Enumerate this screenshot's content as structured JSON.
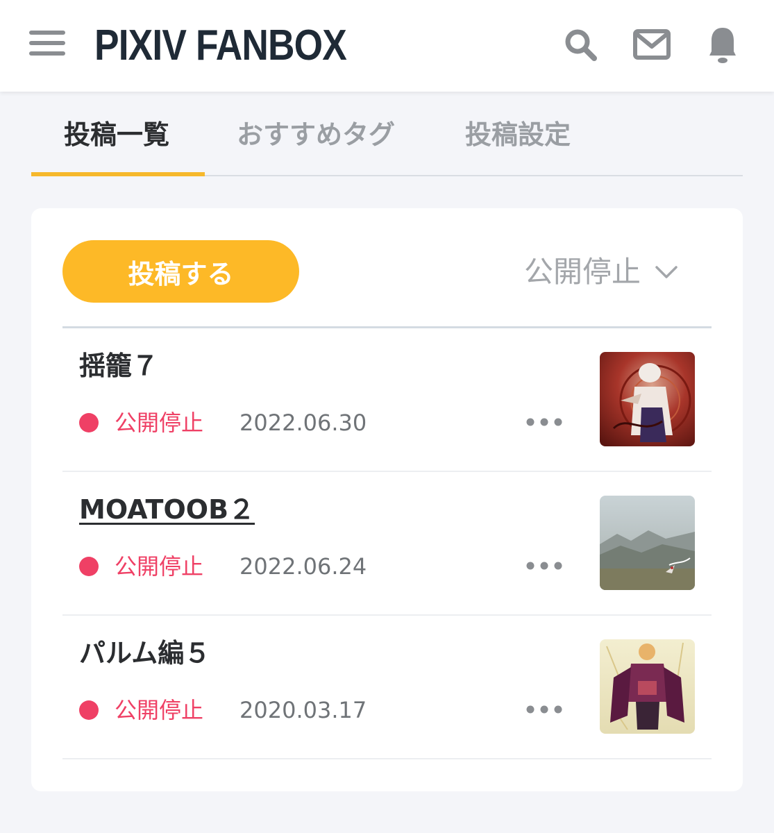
{
  "header": {
    "logo": "PIXIV FANBOX",
    "icons": [
      "menu-icon",
      "search-icon",
      "mail-icon",
      "bell-icon"
    ]
  },
  "tabs": [
    {
      "label": "投稿一覧",
      "active": true
    },
    {
      "label": "おすすめタグ",
      "active": false
    },
    {
      "label": "投稿設定",
      "active": false
    }
  ],
  "toolbar": {
    "post_button_label": "投稿する",
    "filter_selected": "公開停止"
  },
  "posts": [
    {
      "title": "揺籠７",
      "status": "公開停止",
      "date": "2022.06.30",
      "thumbnail": "red-character-artwork"
    },
    {
      "title": "MOATOOB２",
      "status": "公開停止",
      "date": "2022.06.24",
      "thumbnail": "misty-landscape-artwork"
    },
    {
      "title": "パルム編５",
      "status": "公開停止",
      "date": "2020.03.17",
      "thumbnail": "purple-character-artwork"
    }
  ],
  "colors": {
    "accent": "#fdb927",
    "tab_indicator": "#f6b82c",
    "status": "#ef4065",
    "background": "#f4f5f9"
  }
}
